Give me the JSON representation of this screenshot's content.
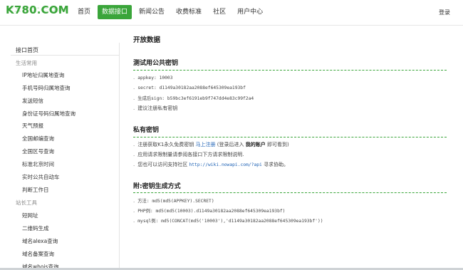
{
  "header": {
    "logo_text": "K780.COM",
    "nav": [
      "首页",
      "数据接口",
      "新闻公告",
      "收费标准",
      "社区",
      "用户中心"
    ],
    "active_nav": "数据接口",
    "login_label": "登录"
  },
  "sidebar": {
    "home": "接口首页",
    "categories": [
      {
        "label": "生活常用",
        "items": [
          "IP地址归属地查询",
          "手机号码归属地查询",
          "发送短信",
          "身份证号码归属地查询",
          "天气预报",
          "全国邮编查询",
          "全国区号查询",
          "标准北京时间",
          "实时公共自动车",
          "判断工作日"
        ]
      },
      {
        "label": "站长工具",
        "items": [
          "短网址",
          "二维码生成",
          "域名alexa查询",
          "域名备案查询",
          "域名whois查询"
        ]
      }
    ]
  },
  "main": {
    "page_title": "开放数据",
    "public_key": {
      "title": "测试用公共密钥",
      "appkey": "appkey: 10003",
      "secret": "secret: d1149a30182aa2088ef645309ea193bf",
      "sign": "生成后sign: b59bc3ef6191eb9f747dd4e83c99f2a4",
      "advice": "建议注册私有密钥"
    },
    "private_key": {
      "title": "私有密钥",
      "line1_prefix": "注册获取K1永久免费密钥",
      "line1_link": "马上注册",
      "line1_mid": "(登录后进入",
      "line1_bold": "我的账户",
      "line1_suffix": "即可看到)",
      "line2": "应用请求限制量请参阅各接口下方请求限制说明.",
      "line3_prefix": "您也可以访问支持社区",
      "line3_link": "http://wiki.nowapi.com/?api",
      "line3_suffix": "寻求协助。"
    },
    "sign_method": {
      "title": "附:密钥生成方式",
      "method": "方法: md5(md5(APPKEY).SECRET)",
      "php": "PHP例: md5(md5(10003).d1149a30182aa2088ef645309ea193bf)",
      "mysql": "mysql例: md5(CONCAT(md5('10003'),'d1149a30182aa2088ef645309ea193bf'))"
    }
  }
}
